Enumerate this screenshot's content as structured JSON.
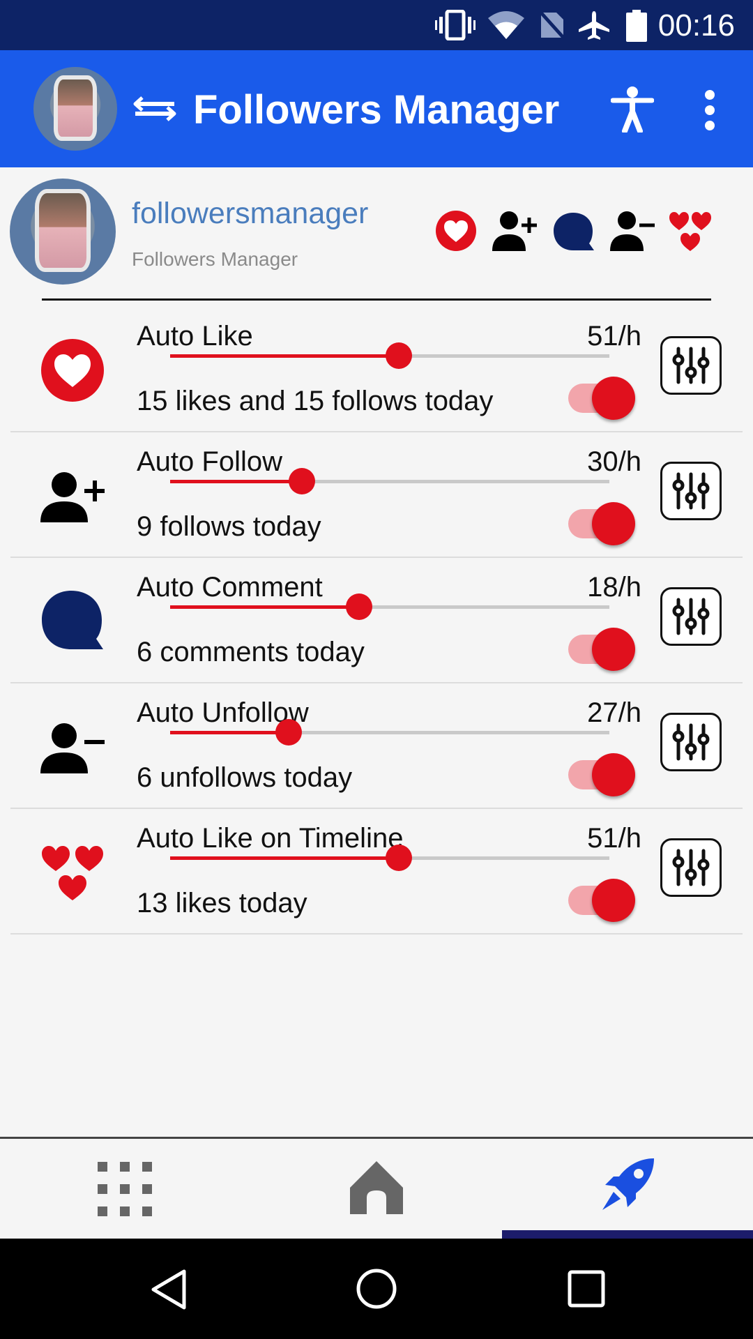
{
  "status_bar": {
    "time": "00:16"
  },
  "app_bar": {
    "title": "Followers Manager"
  },
  "profile": {
    "username": "followersmanager",
    "display_name": "Followers Manager"
  },
  "rows": [
    {
      "title": "Auto Like",
      "rate": "51/h",
      "today": "15 likes and 15 follows today",
      "slider_fraction": 0.52,
      "enabled": true
    },
    {
      "title": "Auto Follow",
      "rate": "30/h",
      "today": "9 follows today",
      "slider_fraction": 0.3,
      "enabled": true
    },
    {
      "title": "Auto Comment",
      "rate": "18/h",
      "today": "6 comments today",
      "slider_fraction": 0.43,
      "enabled": true
    },
    {
      "title": "Auto Unfollow",
      "rate": "27/h",
      "today": "6 unfollows today",
      "slider_fraction": 0.27,
      "enabled": true
    },
    {
      "title": "Auto Like on Timeline",
      "rate": "51/h",
      "today": "13 likes today",
      "slider_fraction": 0.52,
      "enabled": true
    }
  ],
  "colors": {
    "accent": "#e0101d",
    "app_bar": "#1a5bea",
    "status_bar": "#0d2366",
    "comment": "#0d2366",
    "username": "#4a7dbd",
    "nav_active": "#1a4fe0"
  },
  "icons": {
    "app_bar": [
      "avatar",
      "swap-icon",
      "accessibility-icon",
      "more-vert-icon"
    ],
    "profile_actions": [
      "heart-icon",
      "person-add-icon",
      "comment-icon",
      "person-remove-icon",
      "hearts-icon"
    ],
    "bottom_nav": [
      "apps-grid-icon",
      "home-icon",
      "rocket-icon"
    ]
  }
}
